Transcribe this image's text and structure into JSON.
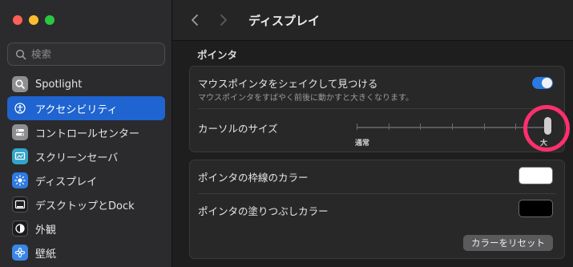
{
  "sidebar": {
    "search": {
      "placeholder": "検索"
    },
    "items": [
      {
        "label": "Spotlight",
        "icon": "magnifier-icon",
        "color": "#8e8e93"
      },
      {
        "label": "アクセシビリティ",
        "icon": "accessibility-icon",
        "color": "#1f64d0",
        "selected": true
      },
      {
        "label": "コントロールセンター",
        "icon": "control-center-icon",
        "color": "#8e8e93"
      },
      {
        "label": "スクリーンセーバ",
        "icon": "screen-saver-icon",
        "color": "#33a5c8"
      },
      {
        "label": "ディスプレイ",
        "icon": "sun-icon",
        "color": "#2f7ae4"
      },
      {
        "label": "デスクトップとDock",
        "icon": "dock-icon",
        "color": "#1c1c1e"
      },
      {
        "label": "外観",
        "icon": "appearance-icon",
        "color": "#1c1c1e"
      },
      {
        "label": "壁紙",
        "icon": "flower-icon",
        "color": "#3a86e8"
      }
    ]
  },
  "toolbar": {
    "title": "ディスプレイ"
  },
  "pointer": {
    "section_title": "ポインタ",
    "shake": {
      "label": "マウスポインタをシェイクして見つける",
      "description": "マウスポインタをすばやく前後に動かすと大きくなります。",
      "enabled": true
    },
    "cursor_size": {
      "label": "カーソルのサイズ",
      "min_label": "通常",
      "max_label": "大",
      "value": 1.0,
      "ticks": 7
    },
    "outline": {
      "label": "ポインタの枠線のカラー",
      "color": "#ffffff"
    },
    "fill": {
      "label": "ポインタの塗りつぶしカラー",
      "color": "#000000"
    },
    "reset_label": "カラーをリセット"
  },
  "colors": {
    "accent": "#1f64d0",
    "toggle_on": "#2a7ae4",
    "highlight_ring": "#ff2f6e"
  }
}
